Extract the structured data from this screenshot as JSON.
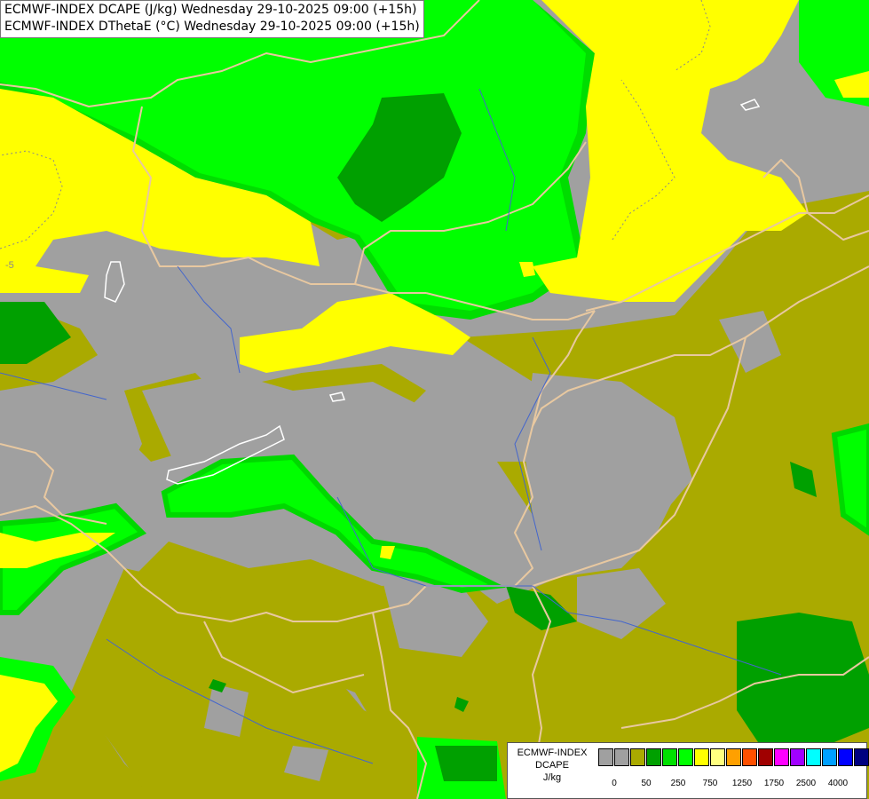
{
  "header": {
    "line1": "ECMWF-INDEX DCAPE (J/kg) Wednesday 29-10-2025 09:00 (+15h)",
    "line2": "ECMWF-INDEX DThetaE (°C) Wednesday 29-10-2025 09:00 (+15h)"
  },
  "map": {
    "contour_label": "-5",
    "fill_colors": {
      "grey": "#a0a0a0",
      "olive": "#aaaa00",
      "dark_green": "#00a000",
      "green": "#00ff00",
      "light_green": "#00ee00",
      "yellow": "#ffff00",
      "border_line": "#e8c8a0",
      "river_line": "#4060c0",
      "lake_outline": "#ffffff"
    }
  },
  "legend": {
    "title_lines": [
      "ECMWF-INDEX",
      "DCAPE",
      "J/kg"
    ],
    "swatch_colors": [
      "#a0a0a0",
      "#a0a0a0",
      "#aaaa00",
      "#00a000",
      "#00e000",
      "#00ff00",
      "#ffff00",
      "#ffff80",
      "#ffa000",
      "#ff5000",
      "#a00000",
      "#ff00ff",
      "#a000ff",
      "#00ffff",
      "#00a0ff",
      "#0000ff",
      "#000080"
    ],
    "tick_labels": [
      "0",
      "50",
      "250",
      "750",
      "1250",
      "1750",
      "2500",
      "4000"
    ]
  }
}
